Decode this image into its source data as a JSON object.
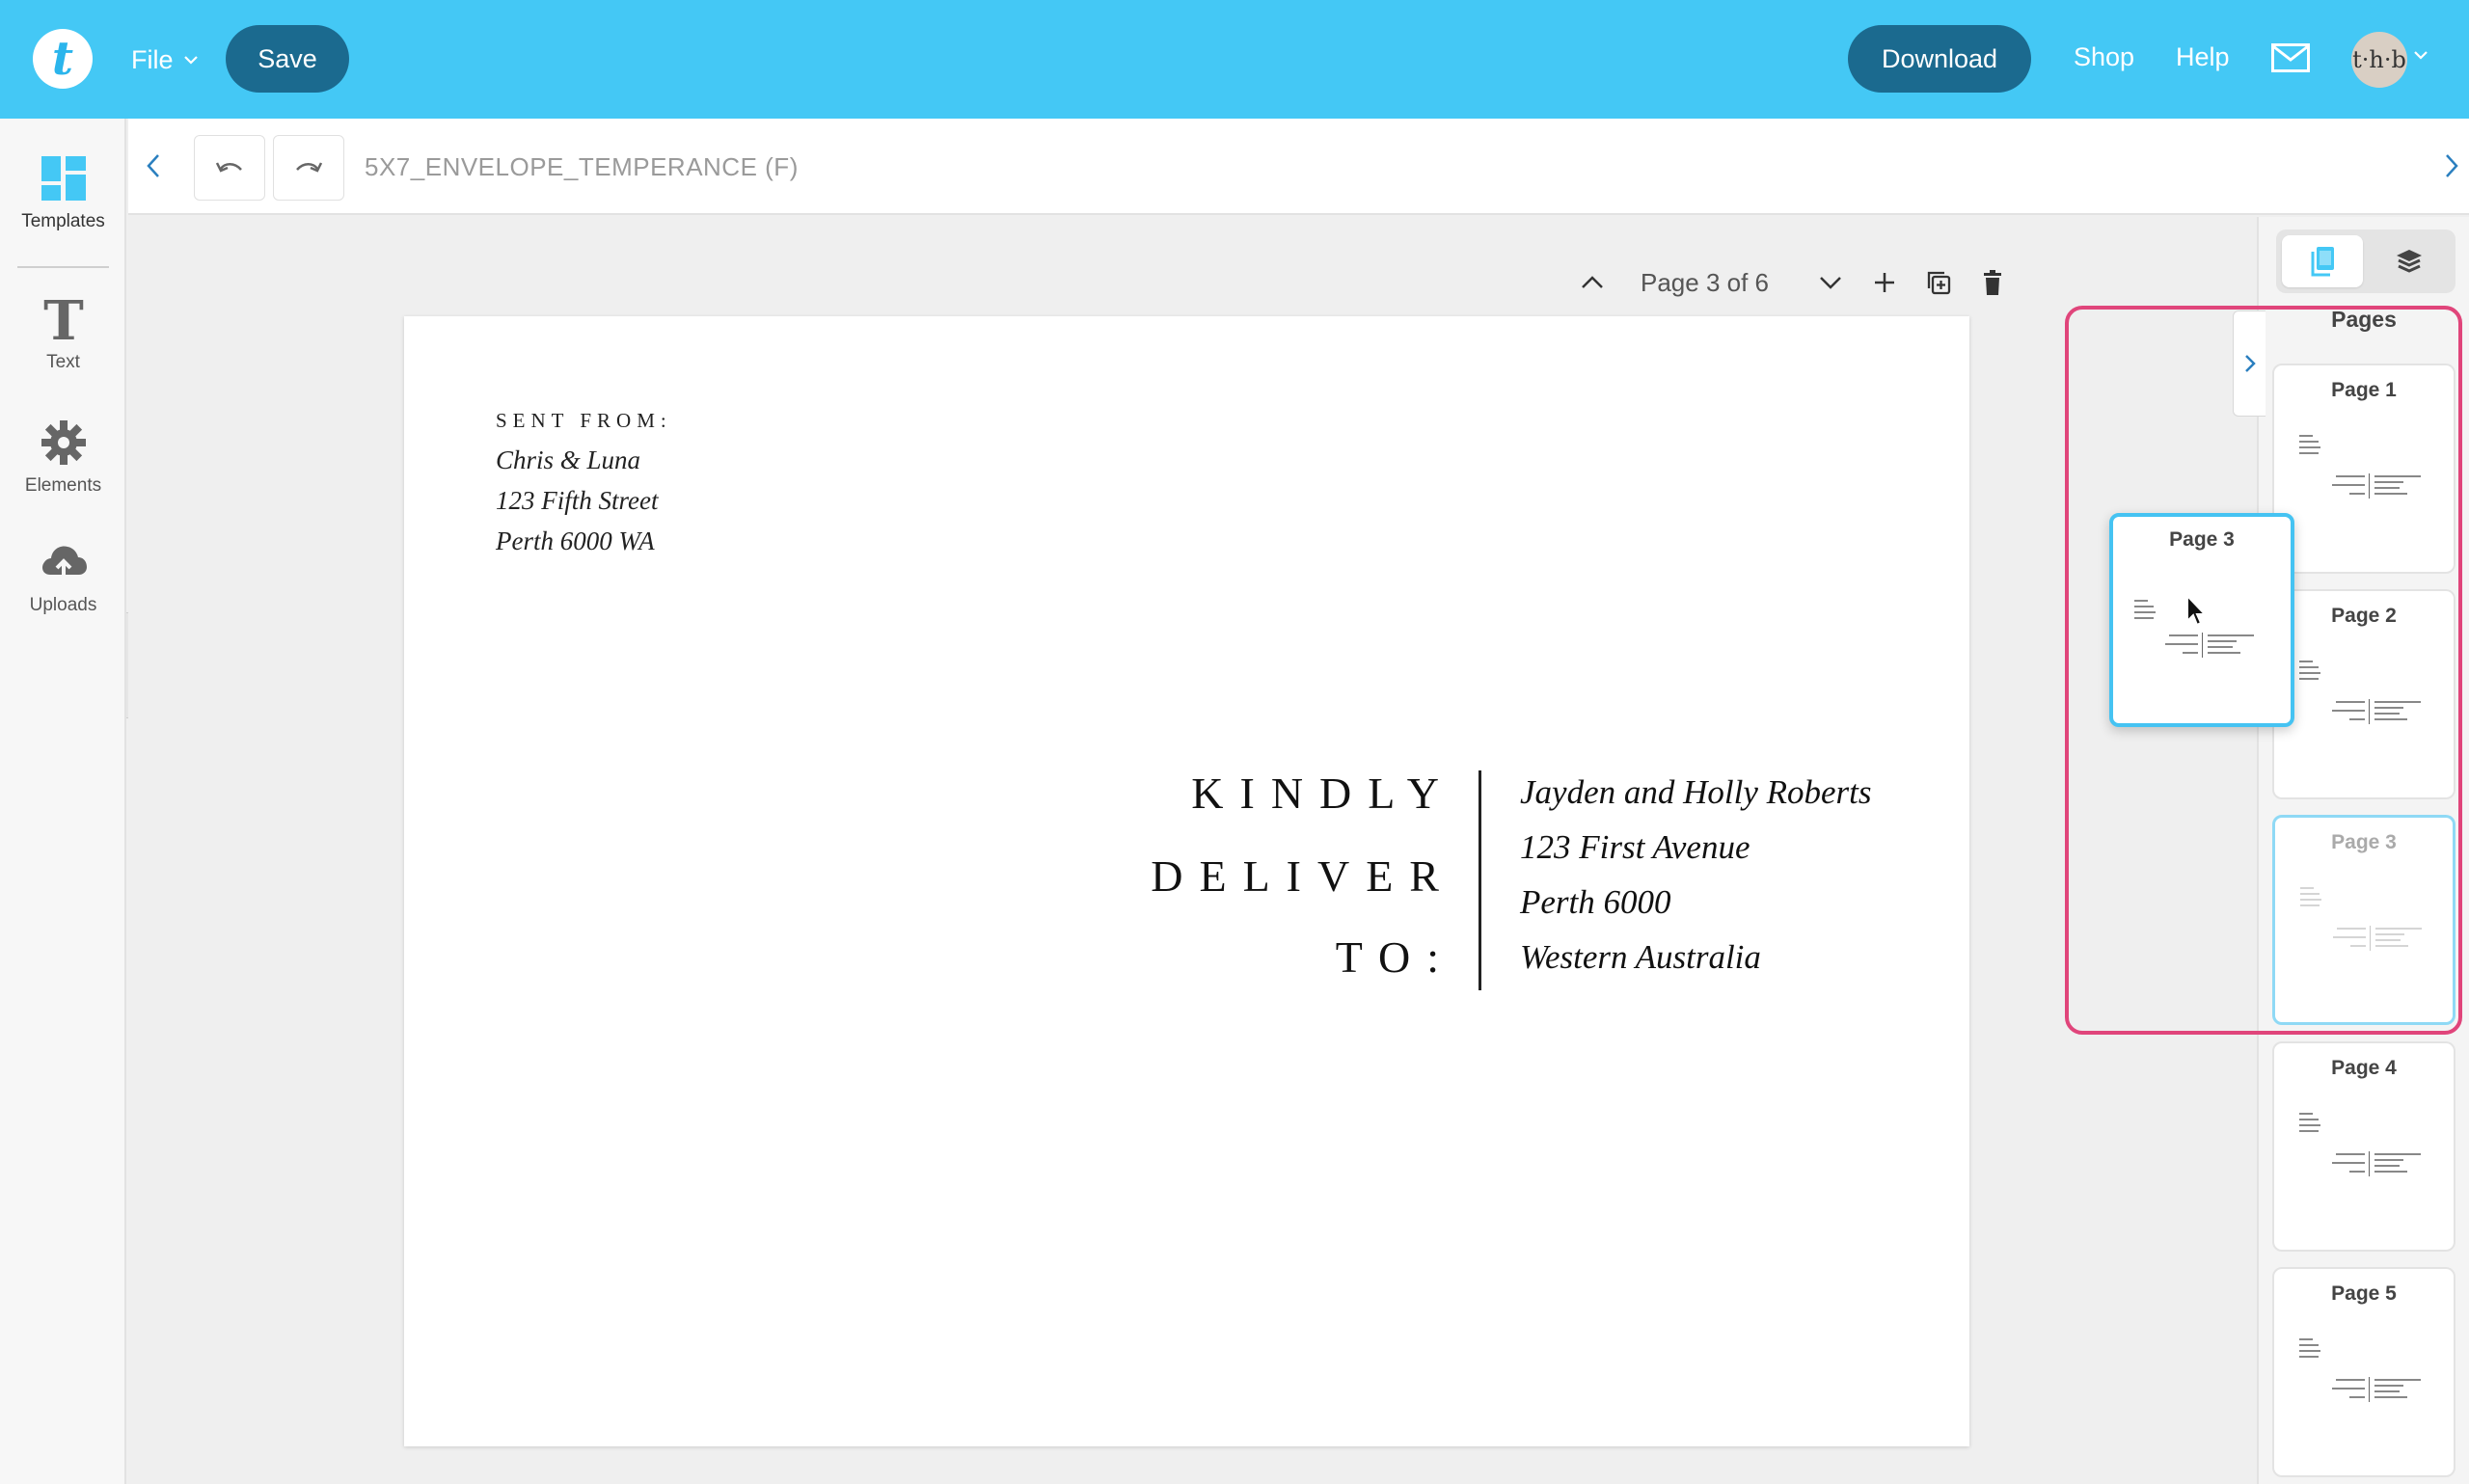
{
  "topbar": {
    "logo_letter": "t",
    "file_label": "File",
    "save_label": "Save",
    "download_label": "Download",
    "shop_label": "Shop",
    "help_label": "Help",
    "avatar_text": "t·h·b",
    "bg_color": "#44c8f5",
    "button_color": "#1b6a8f"
  },
  "sidebar": {
    "items": [
      {
        "label": "Templates",
        "icon": "templates-icon"
      },
      {
        "label": "Text",
        "icon": "text-icon"
      },
      {
        "label": "Elements",
        "icon": "elements-icon"
      },
      {
        "label": "Uploads",
        "icon": "uploads-icon"
      }
    ]
  },
  "toolbar": {
    "document_title": "5X7_ENVELOPE_TEMPERANCE (F)"
  },
  "page_controls": {
    "label": "Page 3 of 6"
  },
  "document": {
    "sent_from_label": "SENT FROM:",
    "sender_lines": [
      "Chris & Luna",
      "123 Fifth Street",
      "Perth 6000 WA"
    ],
    "deliver_lines": [
      "KINDLY",
      "DELIVER",
      "TO:"
    ],
    "recipient_lines": [
      "Jayden and Holly Roberts",
      "123 First Avenue",
      "Perth 6000",
      "Western Australia"
    ]
  },
  "pages_panel": {
    "title": "Pages",
    "thumbnails": [
      "Page 1",
      "Page 2",
      "Page 3",
      "Page 4",
      "Page 5"
    ],
    "dragging_label": "Page 3",
    "accent_color": "#45c3f2",
    "highlight_color": "#e0457b"
  }
}
